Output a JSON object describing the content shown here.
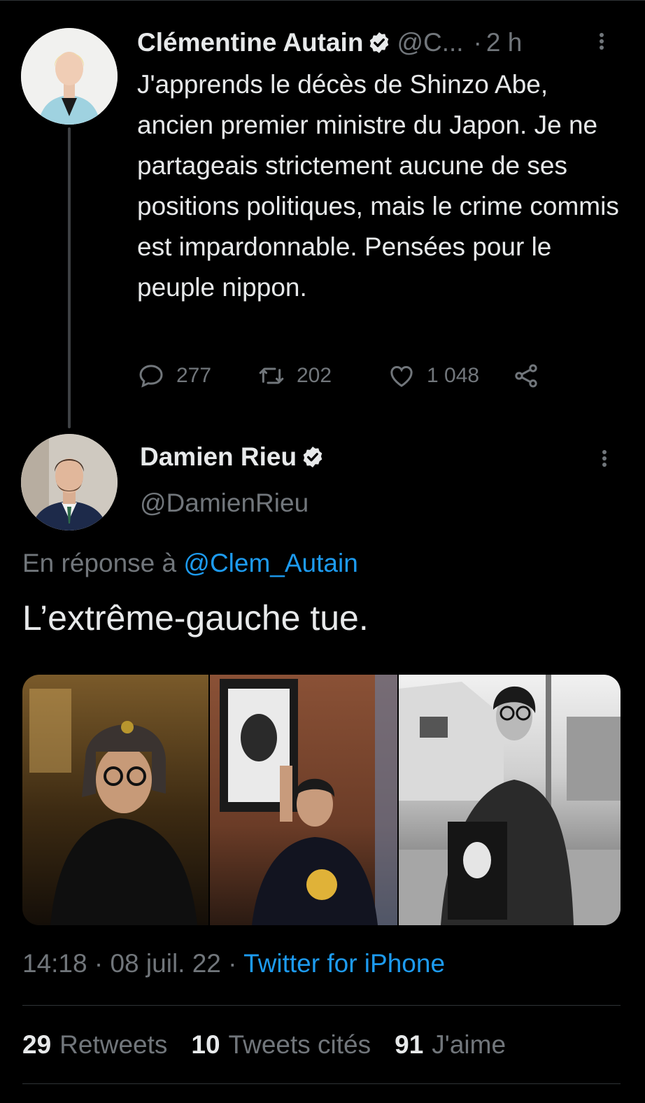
{
  "thread_tweet": {
    "author_name": "Clémentine Autain",
    "handle": "@C...",
    "separator": "·",
    "time": "2 h",
    "text": "J'apprends le décès de Shinzo Abe, ancien premier ministre du Japon. Je ne partageais strictement aucune de ses positions politiques, mais le crime commis est impardonnable. Pensées pour le peuple nippon.",
    "replies": "277",
    "retweets": "202",
    "likes": "1 048",
    "icons": [
      "verified-badge-icon",
      "more-icon",
      "reply-icon",
      "retweet-icon",
      "like-icon",
      "share-icon"
    ]
  },
  "main_tweet": {
    "author_name": "Damien Rieu",
    "handle": "@DamienRieu",
    "reply_prefix": "En réponse à",
    "reply_mention": "@Clem_Autain",
    "text": "L’extrême-gauche tue.",
    "time": "14:18",
    "date": "08 juil. 22",
    "source": "Twitter for iPhone",
    "separator": "·",
    "stats": [
      {
        "count": "29",
        "label": "Retweets"
      },
      {
        "count": "10",
        "label": "Tweets cités"
      },
      {
        "count": "91",
        "label": "J'aime"
      }
    ],
    "media_count": 3
  },
  "colors": {
    "background": "#000000",
    "text": "#e7e9ea",
    "muted": "#71767b",
    "link": "#1d9bf0",
    "divider": "#2f3336"
  }
}
